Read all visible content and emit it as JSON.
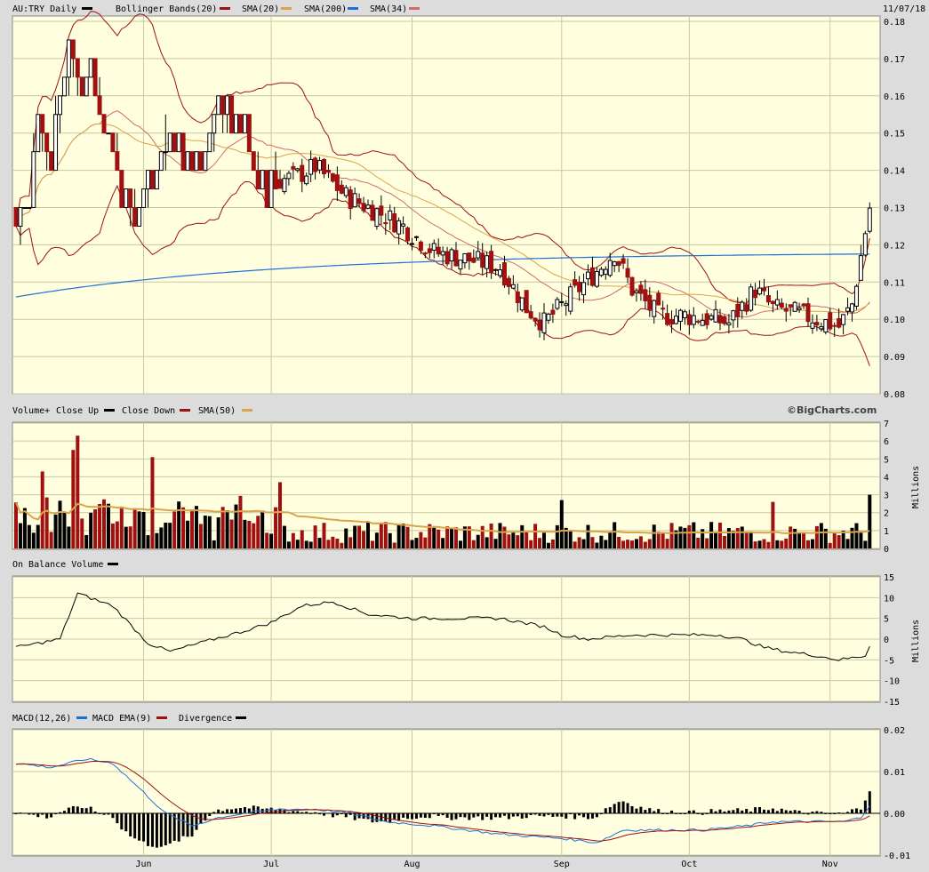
{
  "header": {
    "title": "AU:TRY Daily",
    "date": "11/07/18",
    "legend": [
      {
        "label": "Bollinger Bands(20)",
        "color": "#a01010"
      },
      {
        "label": "SMA(20)",
        "color": "#d9a44a"
      },
      {
        "label": "SMA(200)",
        "color": "#1f6fd6"
      },
      {
        "label": "SMA(34)",
        "color": "#d06a6a"
      }
    ]
  },
  "volume_header": {
    "title": "Volume+",
    "legend": [
      {
        "label": "Close Up",
        "color": "#000000"
      },
      {
        "label": "Close Down",
        "color": "#a01010"
      },
      {
        "label": "SMA(50)",
        "color": "#d9a44a"
      }
    ],
    "copyright": "©BigCharts.com",
    "unit": "Millions"
  },
  "obv_header": {
    "title": "On Balance Volume",
    "unit": "Millions"
  },
  "macd_header": {
    "legend": [
      {
        "label": "MACD(12,26)",
        "color": "#1f6fd6"
      },
      {
        "label": "MACD EMA(9)",
        "color": "#a01010"
      },
      {
        "label": "Divergence",
        "color": "#000000"
      }
    ]
  },
  "colors": {
    "panel_bg": "#ffffdf",
    "up": "#000000",
    "down": "#a01010",
    "bb": "#a01010",
    "sma20": "#d9a44a",
    "sma200": "#1f6fd6",
    "sma34": "#d06a6a"
  },
  "chart_data": [
    {
      "type": "candlestick",
      "title": "AU:TRY Daily",
      "ylim": [
        0.08,
        0.18
      ],
      "yticks": [
        "0.18",
        "0.17",
        "0.16",
        "0.15",
        "0.14",
        "0.13",
        "0.12",
        "0.11",
        "0.10",
        "0.09",
        "0.08"
      ],
      "xticks": [
        {
          "label": "Jun",
          "index": 29
        },
        {
          "label": "Jul",
          "index": 58
        },
        {
          "label": "Aug",
          "index": 90
        },
        {
          "label": "Sep",
          "index": 124
        },
        {
          "label": "Oct",
          "index": 153
        },
        {
          "label": "Nov",
          "index": 185
        }
      ],
      "ohlc": [
        [
          0.13,
          0.13,
          0.125,
          0.125
        ],
        [
          0.125,
          0.13,
          0.12,
          0.13
        ],
        [
          0.13,
          0.13,
          0.13,
          0.13
        ],
        [
          0.13,
          0.13,
          0.13,
          0.13
        ],
        [
          0.13,
          0.15,
          0.13,
          0.145
        ],
        [
          0.145,
          0.155,
          0.145,
          0.155
        ],
        [
          0.155,
          0.155,
          0.145,
          0.15
        ],
        [
          0.15,
          0.15,
          0.14,
          0.145
        ],
        [
          0.145,
          0.145,
          0.14,
          0.14
        ],
        [
          0.14,
          0.16,
          0.14,
          0.155
        ],
        [
          0.155,
          0.16,
          0.15,
          0.16
        ],
        [
          0.16,
          0.16,
          0.16,
          0.165
        ],
        [
          0.165,
          0.175,
          0.16,
          0.175
        ],
        [
          0.175,
          0.175,
          0.165,
          0.17
        ],
        [
          0.17,
          0.17,
          0.16,
          0.165
        ],
        [
          0.165,
          0.165,
          0.16,
          0.16
        ],
        [
          0.16,
          0.165,
          0.16,
          0.165
        ],
        [
          0.165,
          0.17,
          0.165,
          0.17
        ],
        [
          0.17,
          0.17,
          0.16,
          0.16
        ],
        [
          0.16,
          0.165,
          0.155,
          0.155
        ],
        [
          0.155,
          0.155,
          0.15,
          0.15
        ],
        [
          0.15,
          0.15,
          0.15,
          0.15
        ],
        [
          0.15,
          0.15,
          0.145,
          0.145
        ],
        [
          0.145,
          0.15,
          0.14,
          0.14
        ],
        [
          0.14,
          0.14,
          0.13,
          0.13
        ],
        [
          0.13,
          0.135,
          0.13,
          0.135
        ],
        [
          0.135,
          0.135,
          0.125,
          0.13
        ],
        [
          0.13,
          0.135,
          0.125,
          0.125
        ],
        [
          0.125,
          0.13,
          0.125,
          0.13
        ],
        [
          0.13,
          0.135,
          0.13,
          0.135
        ],
        [
          0.135,
          0.14,
          0.13,
          0.14
        ],
        [
          0.14,
          0.14,
          0.135,
          0.135
        ],
        [
          0.135,
          0.14,
          0.135,
          0.14
        ],
        [
          0.14,
          0.145,
          0.14,
          0.145
        ],
        [
          0.145,
          0.155,
          0.14,
          0.145
        ],
        [
          0.145,
          0.15,
          0.145,
          0.15
        ],
        [
          0.15,
          0.15,
          0.145,
          0.145
        ],
        [
          0.145,
          0.15,
          0.145,
          0.15
        ],
        [
          0.15,
          0.15,
          0.14,
          0.14
        ],
        [
          0.14,
          0.145,
          0.14,
          0.145
        ],
        [
          0.145,
          0.145,
          0.14,
          0.14
        ],
        [
          0.14,
          0.145,
          0.14,
          0.145
        ],
        [
          0.145,
          0.145,
          0.14,
          0.14
        ],
        [
          0.14,
          0.145,
          0.14,
          0.145
        ],
        [
          0.145,
          0.15,
          0.145,
          0.15
        ],
        [
          0.15,
          0.155,
          0.145,
          0.155
        ],
        [
          0.155,
          0.16,
          0.155,
          0.16
        ],
        [
          0.16,
          0.16,
          0.15,
          0.155
        ],
        [
          0.155,
          0.16,
          0.15,
          0.16
        ],
        [
          0.16,
          0.16,
          0.15,
          0.15
        ],
        [
          0.15,
          0.155,
          0.15,
          0.155
        ],
        [
          0.155,
          0.155,
          0.15,
          0.15
        ],
        [
          0.15,
          0.155,
          0.15,
          0.155
        ],
        [
          0.155,
          0.15,
          0.145,
          0.145
        ],
        [
          0.145,
          0.145,
          0.14,
          0.14
        ],
        [
          0.14,
          0.145,
          0.135,
          0.135
        ],
        [
          0.135,
          0.14,
          0.135,
          0.14
        ],
        [
          0.14,
          0.14,
          0.13,
          0.13
        ],
        [
          0.13,
          0.14,
          0.13,
          0.14
        ],
        [
          0.14,
          0.145,
          0.135,
          0.135
        ]
      ],
      "series": [
        {
          "name": "Bollinger Bands(20)",
          "color": "#a01010"
        },
        {
          "name": "SMA(20)",
          "color": "#d9a44a"
        },
        {
          "name": "SMA(200)",
          "color": "#1f6fd6"
        },
        {
          "name": "SMA(34)",
          "color": "#d06a6a"
        }
      ]
    },
    {
      "type": "bar",
      "title": "Volume+",
      "ylabel": "Millions",
      "ylim": [
        0,
        7
      ],
      "yticks": [
        "7",
        "6",
        "5",
        "4",
        "3",
        "2",
        "1",
        "0"
      ]
    },
    {
      "type": "line",
      "title": "On Balance Volume",
      "ylabel": "Millions",
      "ylim": [
        -15,
        15
      ],
      "yticks": [
        "15",
        "10",
        "5",
        "0",
        "-5",
        "-10",
        "-15"
      ]
    },
    {
      "type": "line",
      "title": "MACD(12,26)",
      "ylim": [
        -0.01,
        0.02
      ],
      "yticks": [
        "0.02",
        "0.01",
        "0.00",
        "-0.01"
      ]
    }
  ]
}
